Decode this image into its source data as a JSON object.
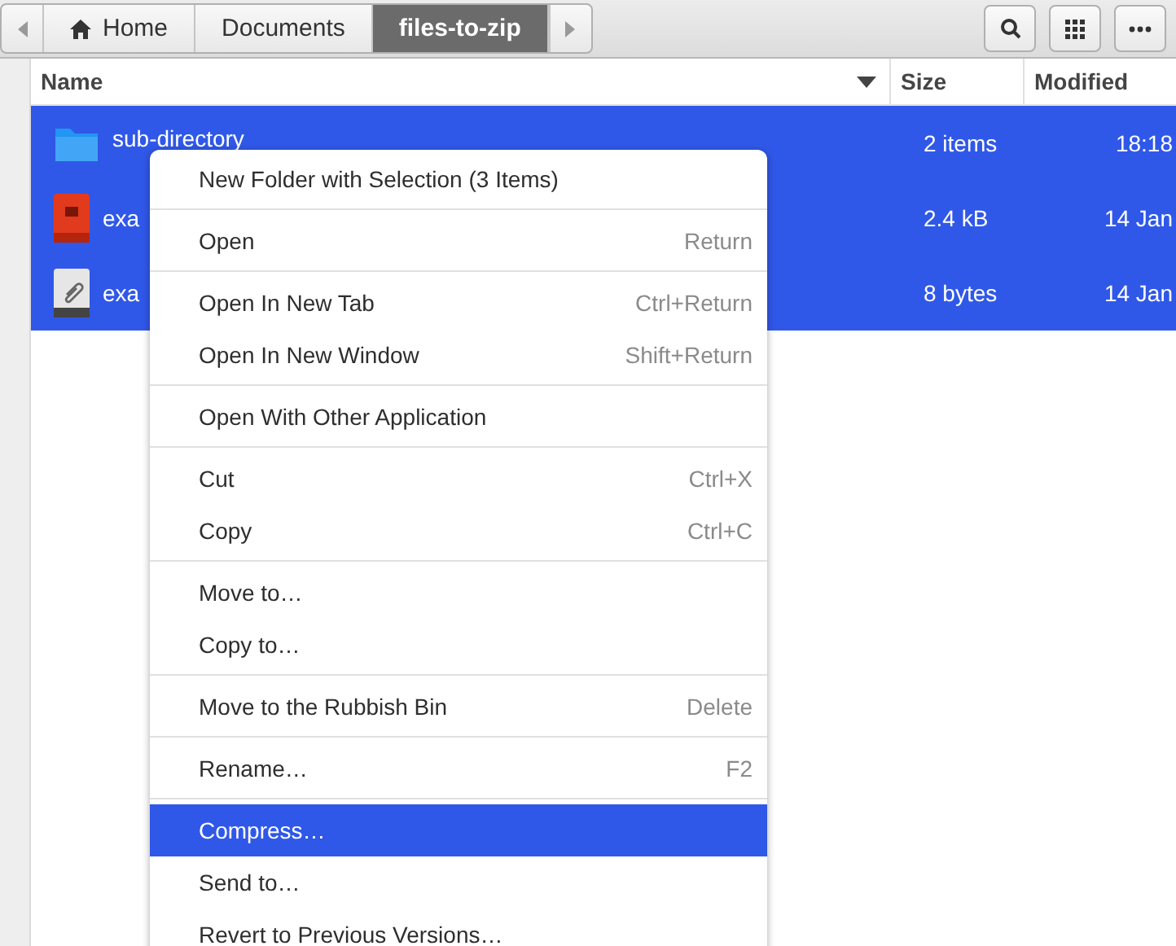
{
  "path_bar": {
    "crumbs": [
      {
        "label": "Home",
        "kind": "home",
        "selected": false
      },
      {
        "label": "Documents",
        "kind": "folder",
        "selected": false
      },
      {
        "label": "files-to-zip",
        "kind": "folder",
        "selected": true
      }
    ]
  },
  "columns": [
    {
      "label": "Name",
      "sorted": true
    },
    {
      "label": "Size",
      "sorted": false
    },
    {
      "label": "Modified",
      "sorted": false
    }
  ],
  "files": [
    {
      "name": "sub-directory",
      "kind": "folder",
      "size": "2 items",
      "modified": "18:18",
      "selected": true
    },
    {
      "name": "exa",
      "kind": "image",
      "size": "2.4 kB",
      "modified": "14 Jan",
      "selected": true
    },
    {
      "name": "exa",
      "kind": "text",
      "size": "8 bytes",
      "modified": "14 Jan",
      "selected": true
    }
  ],
  "context_menu": {
    "sections": [
      [
        {
          "label": "New Folder with Selection (3 Items)",
          "selected": false
        }
      ],
      [
        {
          "label": "Open",
          "shortcut": "Return",
          "selected": false
        }
      ],
      [
        {
          "label": "Open In New Tab",
          "shortcut": "Ctrl+Return",
          "selected": false
        },
        {
          "label": "Open In New Window",
          "shortcut": "Shift+Return",
          "selected": false
        }
      ],
      [
        {
          "label": "Open With Other Application",
          "selected": false
        }
      ],
      [
        {
          "label": "Cut",
          "shortcut": "Ctrl+X",
          "selected": false
        },
        {
          "label": "Copy",
          "shortcut": "Ctrl+C",
          "selected": false
        }
      ],
      [
        {
          "label": "Move to…",
          "selected": false
        },
        {
          "label": "Copy to…",
          "selected": false
        }
      ],
      [
        {
          "label": "Move to the Rubbish Bin",
          "shortcut": "Delete",
          "selected": false
        }
      ],
      [
        {
          "label": "Rename…",
          "shortcut": "F2",
          "selected": false
        }
      ],
      [
        {
          "label": "Compress…",
          "selected": true
        },
        {
          "label": "Send to…",
          "selected": false
        },
        {
          "label": "Revert to Previous Versions…",
          "selected": false
        }
      ]
    ]
  }
}
